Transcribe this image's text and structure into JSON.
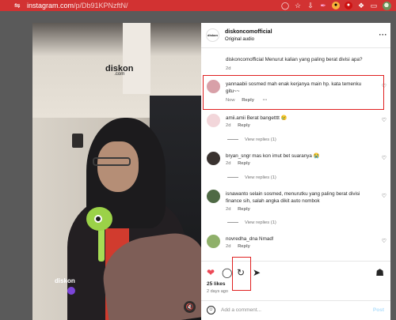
{
  "browser": {
    "url_host": "instagram.com",
    "url_path": "/p/Db91KPNzftN/"
  },
  "media": {
    "watermark": "diskon",
    "watermark_sub": ".com",
    "watermark_bottom": "diskon"
  },
  "post": {
    "username": "diskoncomofficial",
    "audio": "Original audio",
    "avatar_label": "diskon",
    "caption_user": "diskoncomofficial",
    "caption_text": "Menurut kalian yang paling berat divisi apa?",
    "caption_time": "2d",
    "likes": "25 likes",
    "time_ago": "2 days ago"
  },
  "comments": [
    {
      "user": "yannaabii",
      "text": "sosmed mah enak kerjanya main hp. kata temenku gitu~~",
      "time": "Now",
      "reply": "Reply",
      "more": "···",
      "avatar_color": "#d8a0a8"
    },
    {
      "user": "amii.amii",
      "text": "Berat bangetttt 😢",
      "time": "2d",
      "reply": "Reply",
      "view_replies": "View replies (1)",
      "avatar_color": "#f2d6da"
    },
    {
      "user": "bryan_sngr",
      "text": "mas kon imut bet suaranya 😭",
      "time": "2d",
      "reply": "Reply",
      "view_replies": "View replies (1)",
      "avatar_color": "#3a3330"
    },
    {
      "user": "isnawanto",
      "text": "selain sosmed, menurutku yang paling berat divisi finance sih, salah angka dikit auto nombok",
      "time": "2d",
      "reply": "Reply",
      "view_replies": "View replies (1)",
      "avatar_color": "#4f6a45"
    },
    {
      "user": "novredha_dna",
      "text": "Nmad!",
      "time": "2d",
      "reply": "Reply",
      "avatar_color": "#8fb06a"
    }
  ],
  "comment_box": {
    "placeholder": "Add a comment...",
    "post_label": "Post"
  },
  "colors": {
    "highlight": "#e02020",
    "like_red": "#ed4956",
    "browser_bar": "#d23232"
  }
}
